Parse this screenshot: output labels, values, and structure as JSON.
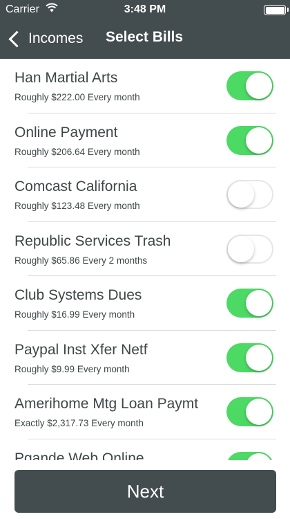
{
  "status_bar": {
    "carrier": "Carrier",
    "time": "3:48 PM"
  },
  "nav": {
    "back_label": "Incomes",
    "title": "Select Bills"
  },
  "bills": [
    {
      "name": "Han Martial Arts",
      "detail": "Roughly $222.00 Every month",
      "selected": true
    },
    {
      "name": "Online Payment",
      "detail": "Roughly $206.64 Every month",
      "selected": true
    },
    {
      "name": "Comcast California",
      "detail": "Roughly $123.48 Every month",
      "selected": false
    },
    {
      "name": "Republic Services Trash",
      "detail": "Roughly $65.86 Every 2 months",
      "selected": false
    },
    {
      "name": "Club Systems Dues",
      "detail": "Roughly $16.99 Every month",
      "selected": true
    },
    {
      "name": "Paypal Inst Xfer Netf",
      "detail": "Roughly $9.99 Every month",
      "selected": true
    },
    {
      "name": "Amerihome Mtg Loan Paymt",
      "detail": "Exactly $2,317.73 Every month",
      "selected": true
    },
    {
      "name": "Pgande Web Online",
      "detail": "",
      "selected": true
    }
  ],
  "footer": {
    "next_label": "Next"
  },
  "colors": {
    "header": "#434c4e",
    "toggle_on": "#4cd964",
    "text": "#3e4647"
  }
}
